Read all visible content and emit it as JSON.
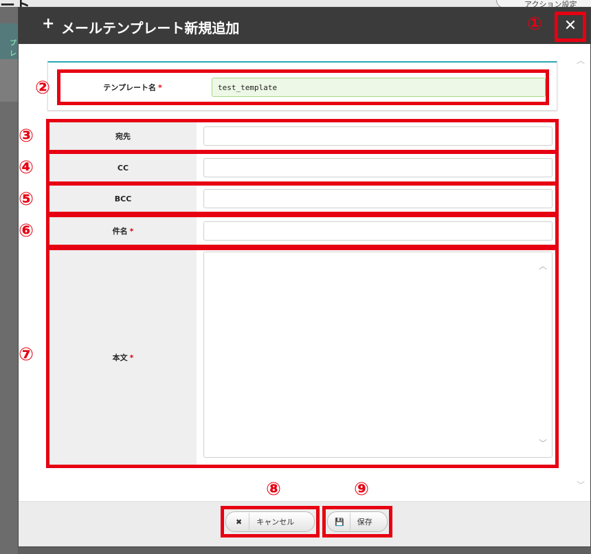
{
  "background": {
    "page_title_fragment": "ート",
    "action_button": "アクション設定",
    "left_strip_text": "プレ"
  },
  "dialog": {
    "title": "メールテンプレート新規追加",
    "close_icon": "close-icon"
  },
  "markers": [
    "①",
    "②",
    "③",
    "④",
    "⑤",
    "⑥",
    "⑦",
    "⑧",
    "⑨"
  ],
  "form": {
    "template_name": {
      "label": "テンプレート名",
      "value": "test_template",
      "required": "*"
    },
    "to": {
      "label": "宛先",
      "value": ""
    },
    "cc": {
      "label": "CC",
      "value": ""
    },
    "bcc": {
      "label": "BCC",
      "value": ""
    },
    "subject": {
      "label": "件名",
      "value": "",
      "required": "*"
    },
    "body": {
      "label": "本文",
      "value": "",
      "required": "*"
    }
  },
  "footer": {
    "cancel_label": "キャンセル",
    "save_label": "保存"
  },
  "colors": {
    "title_bar": "#3b3b3b",
    "annotation_red": "#e60012",
    "accent_teal": "#2aa7b5",
    "filled_input_bg": "#eef8e6"
  }
}
